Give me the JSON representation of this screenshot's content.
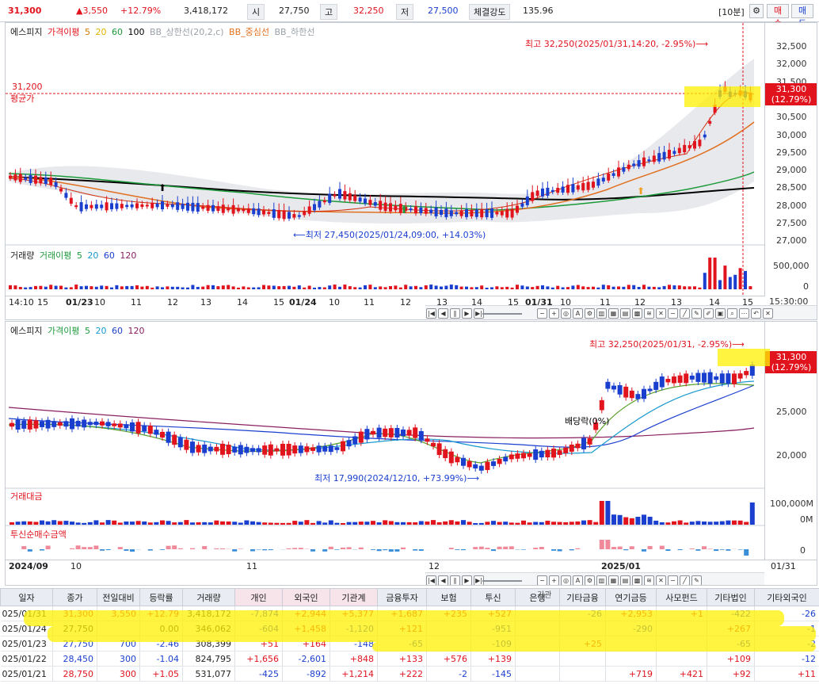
{
  "quote": {
    "price": "31,300",
    "change": "▲3,550",
    "rate": "+12.79%",
    "volume": "3,418,172",
    "open_label": "시",
    "open": "27,750",
    "high_label": "고",
    "high": "32,250",
    "low_label": "저",
    "low": "27,500",
    "strength_label": "체결강도",
    "strength": "135.96",
    "period": "[10분]",
    "settings_icon": "gear-icon",
    "buy": "매수",
    "sell": "매도"
  },
  "chart1": {
    "legend": {
      "name": "에스피지",
      "ma_label": "가격이평",
      "ma5": "5",
      "ma20": "20",
      "ma60": "60",
      "ma100": "100",
      "bb_upper": "BB_상한선(20,2,c)",
      "bb_mid": "BB_중심선",
      "bb_lower": "BB_하한선"
    },
    "y_ticks": [
      "32,500",
      "32,000",
      "31,500",
      "31,000",
      "30,500",
      "30,000",
      "29,500",
      "29,000",
      "28,500",
      "28,000",
      "27,500",
      "27,000"
    ],
    "avg_price": "31,200",
    "avg_label": "평균가",
    "last_price": "31,300",
    "last_rate": "(12.79%)",
    "max_note": "최고 32,250(2025/01/31,14:20, -2.95%)⟶",
    "min_note": "⟵최저 27,450(2025/01/24,09:00, +14.03%)",
    "volume_legend": {
      "name": "거래량",
      "ma_label": "거래이평",
      "v5": "5",
      "v20": "20",
      "v60": "60",
      "v120": "120"
    },
    "vol_ticks": [
      "500,000",
      "0"
    ],
    "x_ticks": [
      "14:10",
      "15",
      "01/23",
      "10",
      "11",
      "12",
      "13",
      "14",
      "15",
      "01/24",
      "10",
      "11",
      "12",
      "13",
      "14",
      "15",
      "01/31",
      "10",
      "11",
      "12",
      "13",
      "14",
      "15"
    ],
    "time_right": "15:30:00"
  },
  "chart2": {
    "legend": {
      "name": "에스피지",
      "ma_label": "가격이평",
      "ma5": "5",
      "ma20": "20",
      "ma60": "60",
      "ma120": "120"
    },
    "y_ticks": [
      "25,000",
      "20,000"
    ],
    "last_price": "31,300",
    "last_rate": "(12.79%)",
    "max_note": "최고 32,250(2025/01/31, -2.95%)⟶",
    "min_note": "최저 17,990(2024/12/10, +73.99%)⟶",
    "dividend": "배당락(0%)",
    "amount_label": "거래대금",
    "amount_ticks": [
      "100,000M",
      "0M"
    ],
    "trust_label": "투신순매수금액",
    "trust_ticks": [
      "0"
    ],
    "x_ticks": [
      "2024/09",
      "10",
      "11",
      "12",
      "2025/01"
    ],
    "x_right": "01/31"
  },
  "table": {
    "group_label": "기관",
    "headers": [
      "일자",
      "종가",
      "전일대비",
      "등락률",
      "거래량",
      "개인",
      "외국인",
      "기관계",
      "금융투자",
      "보험",
      "투신",
      "은행",
      "기타금융",
      "연기금등",
      "사모펀드",
      "기타법인",
      "기타외국인"
    ],
    "rows": [
      [
        "025/01/31",
        "31,300",
        "3,550",
        "+12.79",
        "3,418,172",
        "-7,874",
        "+2,944",
        "+5,377",
        "+1,687",
        "+235",
        "+527",
        "",
        "-26",
        "+2,953",
        "+1",
        "-422",
        "-26"
      ],
      [
        "025/01/24",
        "27,750",
        "",
        "0.00",
        "346,062",
        "-604",
        "+1,458",
        "-1,120",
        "+121",
        "",
        "-951",
        "",
        "",
        "-290",
        "",
        "+267",
        "-1"
      ],
      [
        "025/01/23",
        "27,750",
        "700",
        "-2.46",
        "308,399",
        "+51",
        "+164",
        "-148",
        "-65",
        "",
        "-109",
        "",
        "+25",
        "",
        "",
        "-65",
        "-2"
      ],
      [
        "025/01/22",
        "28,450",
        "300",
        "-1.04",
        "824,795",
        "+1,656",
        "-2,601",
        "+848",
        "+133",
        "+576",
        "+139",
        "",
        "",
        "",
        "",
        "+109",
        "-12"
      ],
      [
        "025/01/21",
        "28,750",
        "300",
        "+1.05",
        "531,077",
        "-425",
        "-892",
        "+1,214",
        "+222",
        "-2",
        "-145",
        "",
        "",
        "+719",
        "+421",
        "+92",
        "+11"
      ]
    ]
  }
}
